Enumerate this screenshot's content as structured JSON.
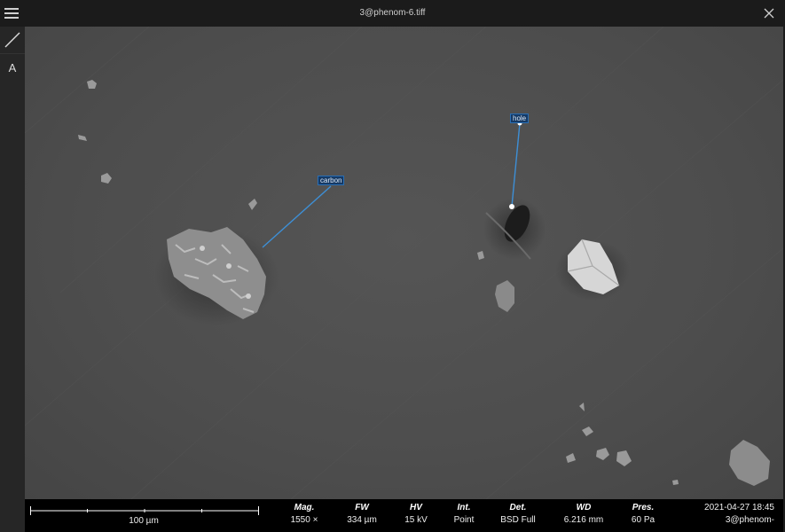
{
  "window": {
    "title": "3@phenom-6.tiff"
  },
  "toolbar": {
    "line_tool": "line-tool",
    "text_tool_label": "A"
  },
  "annotations": [
    {
      "label": "carbon"
    },
    {
      "label": "hole"
    }
  ],
  "databar": {
    "scale_label": "100 µm",
    "fields": [
      {
        "header": "Mag.",
        "value": "1550 ×"
      },
      {
        "header": "FW",
        "value": "334 µm"
      },
      {
        "header": "HV",
        "value": "15 kV"
      },
      {
        "header": "Int.",
        "value": "Point"
      },
      {
        "header": "Det.",
        "value": "BSD Full"
      },
      {
        "header": "WD",
        "value": "6.216 mm"
      },
      {
        "header": "Pres.",
        "value": "60 Pa"
      }
    ],
    "datetime": "2021-04-27 18:45",
    "source": "3@phenom-"
  },
  "colors": {
    "annotation_line": "#3d8fd6",
    "background": "#4f4f4f"
  }
}
